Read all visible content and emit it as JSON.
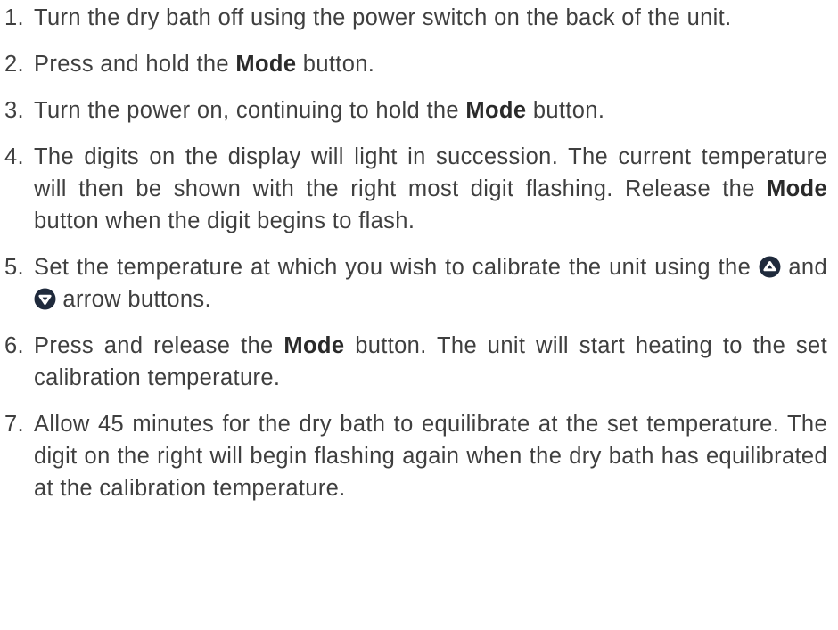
{
  "steps": [
    {
      "num": "1.",
      "text": "Turn the dry bath off using the power switch on the back of the unit."
    },
    {
      "num": "2.",
      "pre": "Press and hold the ",
      "bold": "Mode",
      "post": " button."
    },
    {
      "num": "3.",
      "pre": "Turn the power on, continuing to hold the ",
      "bold": "Mode",
      "post": " button."
    },
    {
      "num": "4.",
      "pre": "The digits on the display will light in succession. The current temperature will then be shown with the right most digit flashing. Release the ",
      "bold": "Mode",
      "post": " button when the digit begins to flash."
    },
    {
      "num": "5.",
      "pre": "Set the temperature at which you wish to calibrate the unit using the ",
      "mid": " and ",
      "post": " arrow buttons.",
      "icon_up": "up-arrow-button-icon",
      "icon_down": "down-arrow-button-icon"
    },
    {
      "num": "6.",
      "pre": "Press and release the ",
      "bold": "Mode",
      "post": " button. The unit will start heating to the set calibration temperature."
    },
    {
      "num": "7.",
      "text": "Allow 45 minutes for the dry bath to equilibrate at the set temperature. The digit on the right will begin flashing again when the dry bath has equilibrated at the calibration temperature."
    }
  ],
  "colors": {
    "text": "#3f3f3f",
    "icon_fill": "#1f2a3c",
    "icon_arrow": "#ffffff"
  }
}
